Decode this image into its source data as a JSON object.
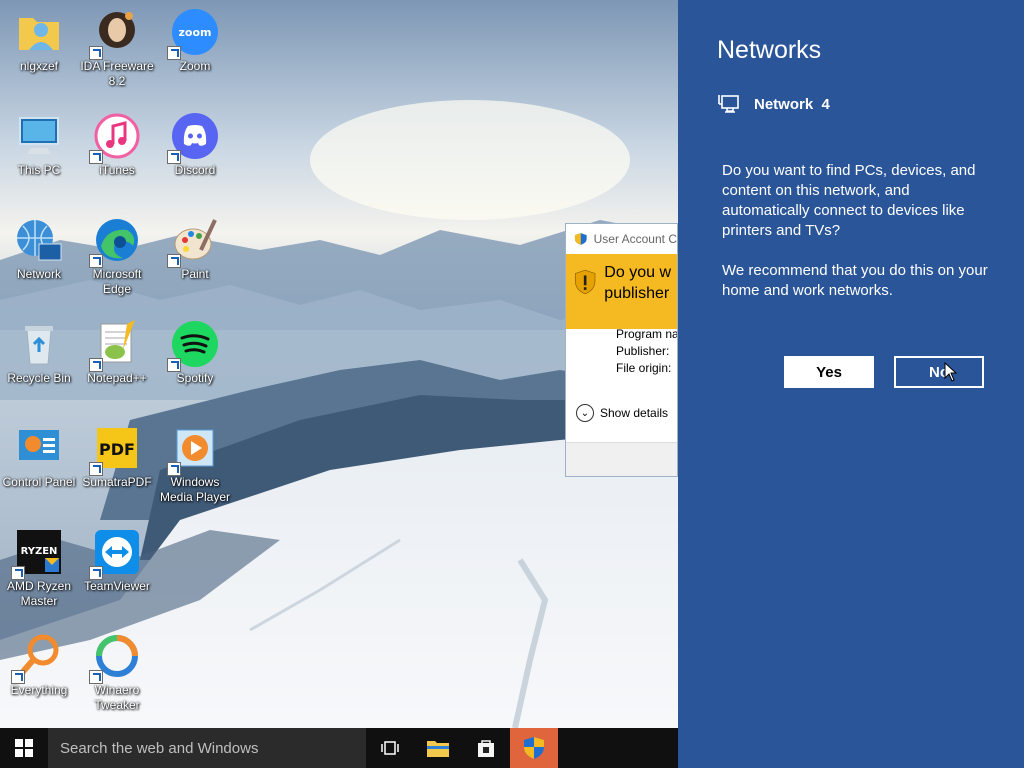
{
  "desktop": {
    "icons": [
      {
        "label": "nlgxzef",
        "icon": "user-folder-icon"
      },
      {
        "label": "IDA Freeware 8.2",
        "icon": "ida-icon"
      },
      {
        "label": "Zoom",
        "icon": "zoom-icon",
        "glyph": "zoom"
      },
      {
        "label": "This PC",
        "icon": "computer-icon"
      },
      {
        "label": "iTunes",
        "icon": "itunes-icon"
      },
      {
        "label": "Discord",
        "icon": "discord-icon"
      },
      {
        "label": "Network",
        "icon": "network-icon"
      },
      {
        "label": "Microsoft Edge",
        "icon": "edge-icon"
      },
      {
        "label": "Paint",
        "icon": "paint-icon"
      },
      {
        "label": "Recycle Bin",
        "icon": "recycle-bin-icon"
      },
      {
        "label": "Notepad++",
        "icon": "notepadpp-icon"
      },
      {
        "label": "Spotify",
        "icon": "spotify-icon"
      },
      {
        "label": "Control Panel",
        "icon": "control-panel-icon"
      },
      {
        "label": "SumatraPDF",
        "icon": "sumatrapdf-icon",
        "glyph": "PDF"
      },
      {
        "label": "Windows Media Player",
        "icon": "media-player-icon"
      },
      {
        "label": "AMD Ryzen Master",
        "icon": "ryzen-icon",
        "glyph": "RYZEN"
      },
      {
        "label": "TeamViewer",
        "icon": "teamviewer-icon"
      },
      {
        "label": "Everything",
        "icon": "everything-icon"
      },
      {
        "label": "Winaero Tweaker",
        "icon": "winaero-icon"
      }
    ]
  },
  "uac": {
    "title": "User Account C",
    "question": "Do you w",
    "question2": "publisher",
    "program_label": "Program na",
    "publisher_label": "Publisher:",
    "origin_label": "File origin:",
    "details": "Show details"
  },
  "networks": {
    "title": "Networks",
    "network_name": "Network  4",
    "question": "Do you want to find PCs, devices, and content on this network, and automatically connect to devices like printers and TVs?",
    "recommendation": "We recommend that you do this on your home and work networks.",
    "yes_label": "Yes",
    "no_label": "No"
  },
  "taskbar": {
    "search_placeholder": "Search the web and Windows"
  },
  "colors": {
    "pane": "#2a5598",
    "uac_banner": "#f5b921",
    "taskbar": "#101010",
    "active_task": "#e0653d"
  }
}
